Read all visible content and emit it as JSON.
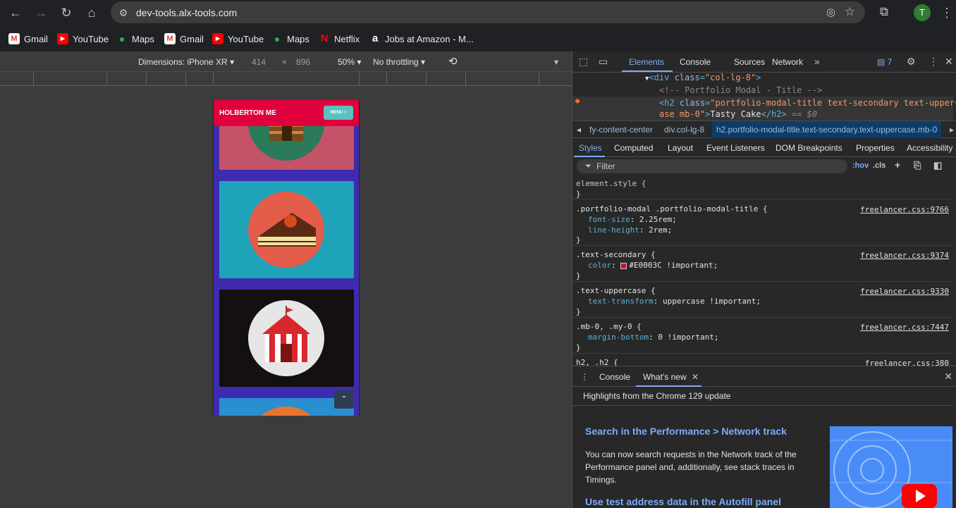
{
  "browser": {
    "url": "dev-tools.alx-tools.com",
    "profile_initial": "T"
  },
  "bookmarks": [
    {
      "label": "Gmail",
      "icon": "gmail-icon"
    },
    {
      "label": "YouTube",
      "icon": "youtube-icon"
    },
    {
      "label": "Maps",
      "icon": "maps-icon"
    },
    {
      "label": "Gmail",
      "icon": "gmail-icon"
    },
    {
      "label": "YouTube",
      "icon": "youtube-icon"
    },
    {
      "label": "Maps",
      "icon": "maps-icon"
    },
    {
      "label": "Netflix",
      "icon": "netflix-icon"
    },
    {
      "label": "Jobs at Amazon - M...",
      "icon": "amazon-icon"
    }
  ],
  "device_toolbar": {
    "dimensions": "Dimensions: iPhone XR",
    "width": "414",
    "height": "896",
    "zoom": "50%",
    "throttling": "No throttling"
  },
  "phone": {
    "brand": "HOLBERTON ME",
    "menu_label": "MENU ≡",
    "accent": "#e0003c"
  },
  "devtools": {
    "tabs": [
      "Elements",
      "Console",
      "Sources",
      "Network"
    ],
    "issues_count": "7",
    "dom": {
      "line1_tag": "<div",
      "line1_attr": "class",
      "line1_val": "\"col-lg-8\"",
      "line2_comment": "<!-- Portfolio Modal - Title -->",
      "line3_tag": "<h2",
      "line3_attr": "class",
      "line3_val_a": "\"portfolio-modal-title text-secondary text-upperc",
      "line4_val_b": "ase mb-0\"",
      "line4_text": "Tasty Cake",
      "line4_close": "</h2>",
      "line4_marker": "== $0"
    },
    "breadcrumbs": {
      "crumb1": "fy-content-center",
      "crumb2": "div.col-lg-8",
      "active": "h2.portfolio-modal-title.text-secondary.text-uppercase.mb-0"
    },
    "style_tabs": [
      "Styles",
      "Computed",
      "Layout",
      "Event Listeners",
      "DOM Breakpoints",
      "Properties",
      "Accessibility"
    ],
    "filter_placeholder": "Filter",
    "hov": ":hov",
    "cls": ".cls",
    "rules": {
      "element_style": "element.style {",
      "close": "}",
      "r1_sel": ".portfolio-modal .portfolio-modal-title {",
      "r1_src": "freelancer.css:9766",
      "r1_p1_name": "font-size",
      "r1_p1_val": "2.25rem;",
      "r1_p2_name": "line-height",
      "r1_p2_val": "2rem;",
      "r2_sel": ".text-secondary {",
      "r2_src": "freelancer.css:9374",
      "r2_p1_name": "color",
      "r2_p1_val": "#E0003C !important;",
      "r3_sel": ".text-uppercase {",
      "r3_src": "freelancer.css:9330",
      "r3_p1_name": "text-transform",
      "r3_p1_val": "uppercase !important;",
      "r4_sel": ".mb-0, .my-0 {",
      "r4_src": "freelancer.css:7447",
      "r4_p1_name": "margin-bottom",
      "r4_p1_val": "0 !important;",
      "r5_sel": "h2, .h2 {",
      "r5_src": "freelancer.css:380"
    },
    "drawer": {
      "tabs": [
        "Console",
        "What's new"
      ],
      "highlights": "Highlights from the Chrome 129 update",
      "item1_title": "Search in the Performance > Network track",
      "item1_body": "You can now search requests in the Network track of the Performance panel and, additionally, see stack traces in Timings.",
      "item2_title": "Use test address data in the Autofill panel"
    }
  }
}
